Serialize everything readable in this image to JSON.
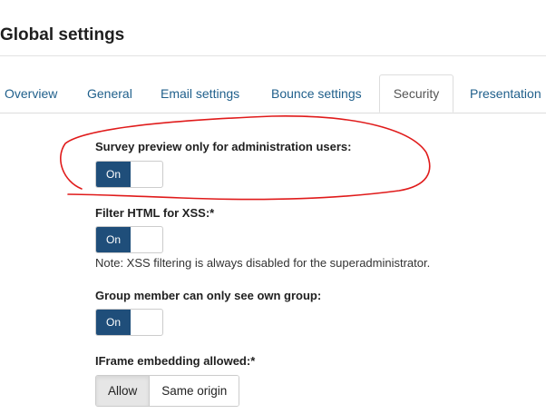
{
  "page": {
    "title": "Global settings"
  },
  "tabs": [
    {
      "label": "Overview",
      "active": false
    },
    {
      "label": "General",
      "active": false
    },
    {
      "label": "Email settings",
      "active": false
    },
    {
      "label": "Bounce settings",
      "active": false
    },
    {
      "label": "Security",
      "active": true
    },
    {
      "label": "Presentation",
      "active": false
    }
  ],
  "settings": {
    "survey_preview": {
      "label": "Survey preview only for administration users:",
      "state": "On"
    },
    "filter_xss": {
      "label": "Filter HTML for XSS:*",
      "state": "On",
      "note": "Note: XSS filtering is always disabled for the superadministrator."
    },
    "group_member": {
      "label": "Group member can only see own group:",
      "state": "On"
    },
    "iframe": {
      "label": "IFrame embedding allowed:*",
      "options": [
        "Allow",
        "Same origin"
      ],
      "selected": "Allow"
    }
  },
  "colors": {
    "toggle_on": "#1f4e7a",
    "tab_link": "#1f5f8b",
    "annotation": "#e01b1b"
  }
}
